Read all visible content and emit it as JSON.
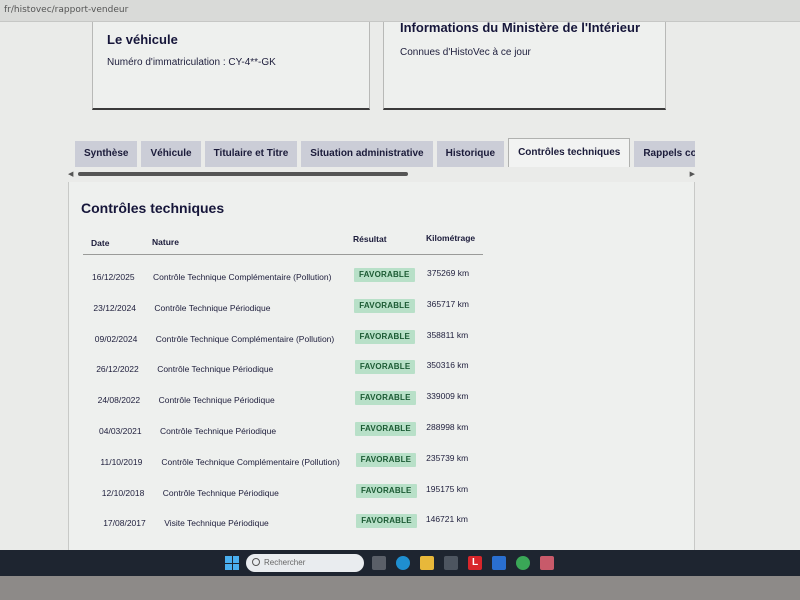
{
  "browser": {
    "url": "fr/histovec/rapport-vendeur"
  },
  "vehicle_card": {
    "title": "Le véhicule",
    "plate_label": "Numéro d'immatriculation : CY-4**-GK"
  },
  "ministry_card": {
    "title": "Informations du Ministère de l'Intérieur",
    "subtitle": "Connues d'HistoVec à ce jour"
  },
  "tabs": [
    {
      "label": "Synthèse",
      "active": false
    },
    {
      "label": "Véhicule",
      "active": false
    },
    {
      "label": "Titulaire et Titre",
      "active": false
    },
    {
      "label": "Situation administrative",
      "active": false
    },
    {
      "label": "Historique",
      "active": false
    },
    {
      "label": "Contrôles techniques",
      "active": true
    },
    {
      "label": "Rappels constructeur",
      "active": false
    }
  ],
  "section": {
    "title": "Contrôles techniques",
    "columns": {
      "date": "Date",
      "nature": "Nature",
      "result": "Résultat",
      "mileage": "Kilométrage"
    },
    "rows": [
      {
        "date": "16/12/2025",
        "nature": "Contrôle Technique Complémentaire (Pollution)",
        "result": "FAVORABLE",
        "mileage": "375269 km"
      },
      {
        "date": "23/12/2024",
        "nature": "Contrôle Technique Périodique",
        "result": "FAVORABLE",
        "mileage": "365717 km"
      },
      {
        "date": "09/02/2024",
        "nature": "Contrôle Technique Complémentaire (Pollution)",
        "result": "FAVORABLE",
        "mileage": "358811 km"
      },
      {
        "date": "26/12/2022",
        "nature": "Contrôle Technique Périodique",
        "result": "FAVORABLE",
        "mileage": "350316 km"
      },
      {
        "date": "24/08/2022",
        "nature": "Contrôle Technique Périodique",
        "result": "FAVORABLE",
        "mileage": "339009 km"
      },
      {
        "date": "04/03/2021",
        "nature": "Contrôle Technique Périodique",
        "result": "FAVORABLE",
        "mileage": "288998 km"
      },
      {
        "date": "11/10/2019",
        "nature": "Contrôle Technique Complémentaire (Pollution)",
        "result": "FAVORABLE",
        "mileage": "235739 km"
      },
      {
        "date": "12/10/2018",
        "nature": "Contrôle Technique Périodique",
        "result": "FAVORABLE",
        "mileage": "195175 km"
      },
      {
        "date": "17/08/2017",
        "nature": "Visite Technique Périodique",
        "result": "FAVORABLE",
        "mileage": "146721 km"
      }
    ]
  },
  "taskbar": {
    "search_placeholder": "Rechercher",
    "icons": [
      "windows-start-icon",
      "task-view-icon",
      "edge-icon",
      "file-explorer-icon",
      "store-icon",
      "app-l-icon",
      "mail-icon",
      "chrome-icon",
      "app-icon"
    ]
  },
  "colors": {
    "badge_bg": "#b8e0c8",
    "badge_text": "#1b5a33",
    "tab_bg": "#cbcdd7",
    "taskbar": "#1e2530"
  }
}
